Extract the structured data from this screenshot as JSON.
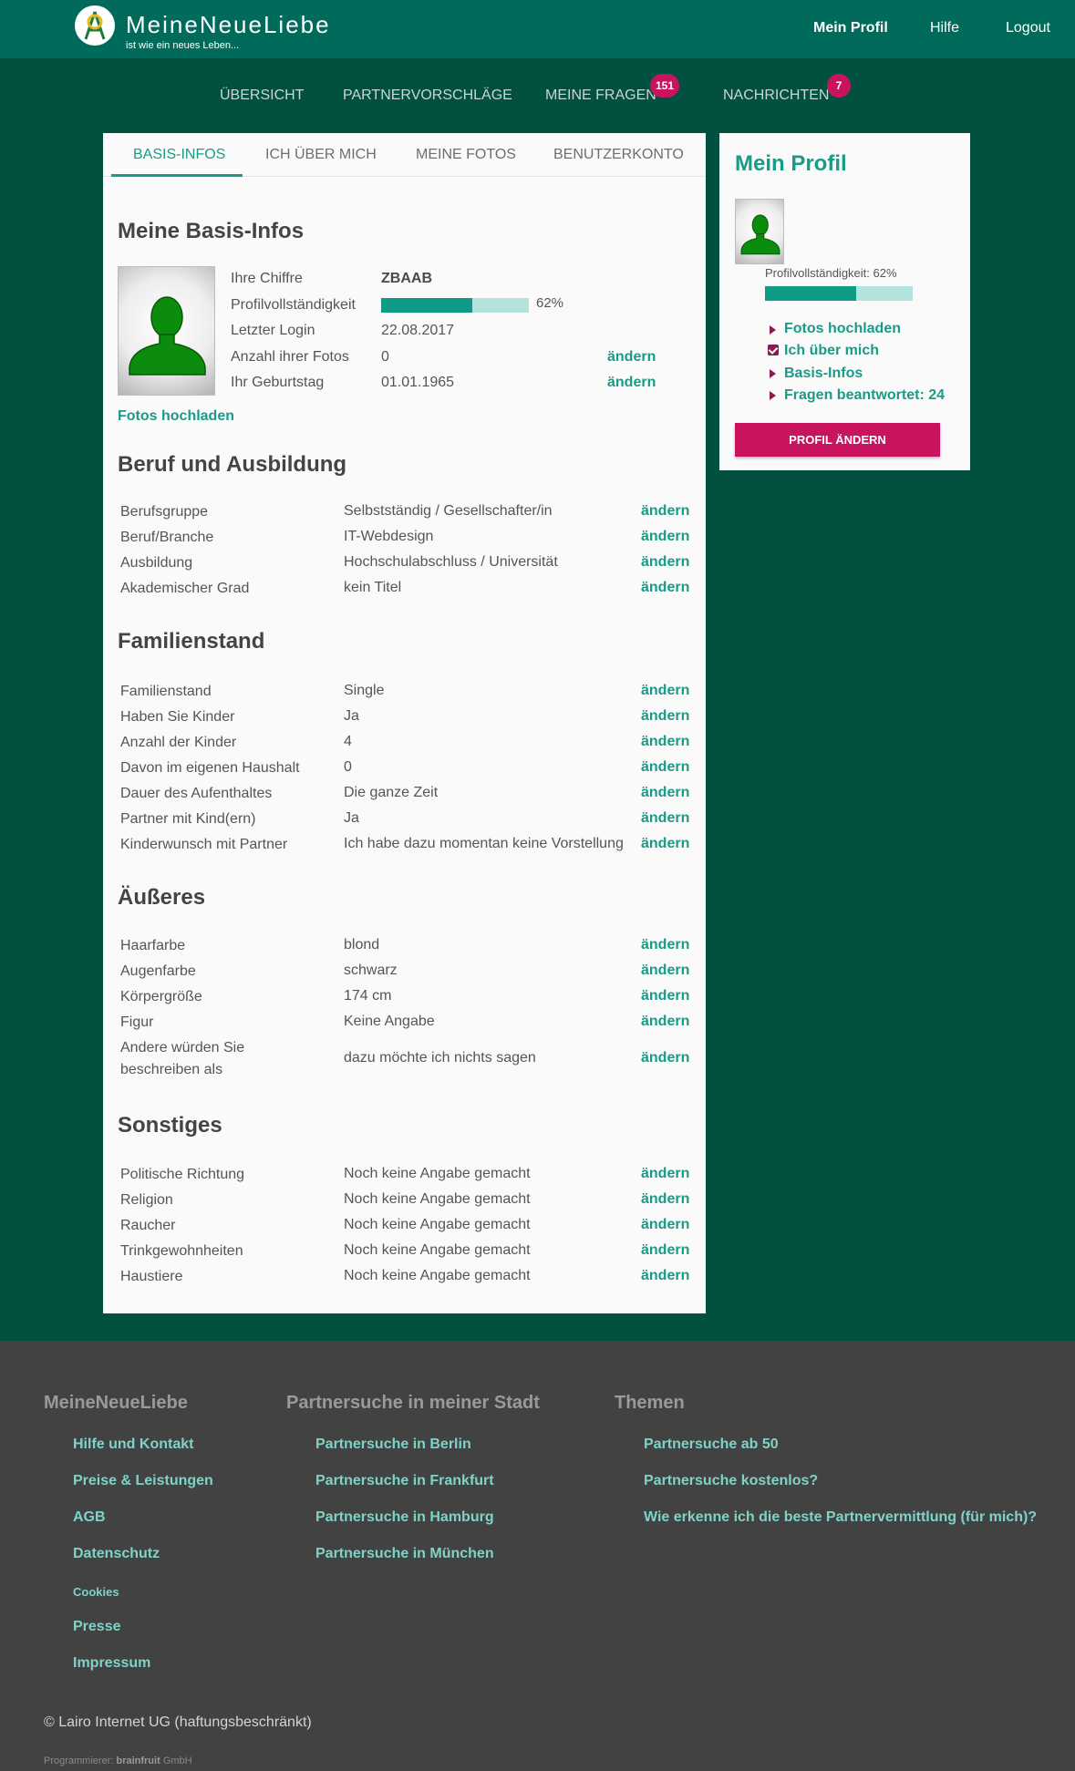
{
  "header": {
    "brand_title": "MeineNeueLiebe",
    "brand_tagline": "ist wie ein neues Leben...",
    "nav": {
      "profile": "Mein Profil",
      "help": "Hilfe",
      "logout": "Logout"
    }
  },
  "main_nav": {
    "items": [
      {
        "label": "Übersicht"
      },
      {
        "label": "Partnervorschläge"
      },
      {
        "label": "Meine Fragen",
        "badge": "151"
      },
      {
        "label": "Nachrichten",
        "badge": "7"
      }
    ]
  },
  "tabs": [
    "Basis-Infos",
    "Ich über mich",
    "Meine Fotos",
    "Benutzerkonto"
  ],
  "basis": {
    "title": "Meine Basis-Infos",
    "chiffre_label": "Ihre Chiffre",
    "chiffre_value": "ZBAAB",
    "completeness_label": "Profilvollständigkeit",
    "completeness_percent": 62,
    "completeness_text": "62%",
    "login_label": "Letzter Login",
    "login_value": "22.08.2017",
    "photos_label": "Anzahl ihrer Fotos",
    "photos_value": "0",
    "birthday_label": "Ihr Geburtstag",
    "birthday_value": "01.01.1965",
    "edit_label": "ändern",
    "upload_label": "Fotos hochladen"
  },
  "sections": [
    {
      "title": "Beruf und Ausbildung",
      "rows": [
        {
          "label": "Berufsgruppe",
          "value": "Selbstständig / Gesellschafter/in"
        },
        {
          "label": "Beruf/Branche",
          "value": "IT-Webdesign"
        },
        {
          "label": "Ausbildung",
          "value": "Hochschulabschluss / Universität"
        },
        {
          "label": "Akademischer Grad",
          "value": "kein Titel"
        }
      ]
    },
    {
      "title": "Familienstand",
      "rows": [
        {
          "label": "Familienstand",
          "value": "Single"
        },
        {
          "label": "Haben Sie Kinder",
          "value": "Ja"
        },
        {
          "label": "Anzahl der Kinder",
          "value": "4"
        },
        {
          "label": "Davon im eigenen Haushalt",
          "value": "0"
        },
        {
          "label": "Dauer des Aufenthaltes",
          "value": "Die ganze Zeit"
        },
        {
          "label": "Partner mit Kind(ern)",
          "value": "Ja"
        },
        {
          "label": "Kinderwunsch mit Partner",
          "value": "Ich habe dazu momentan keine Vorstellung"
        }
      ]
    },
    {
      "title": "Äußeres",
      "rows": [
        {
          "label": "Haarfarbe",
          "value": "blond"
        },
        {
          "label": "Augenfarbe",
          "value": "schwarz"
        },
        {
          "label": "Körpergröße",
          "value": "174 cm"
        },
        {
          "label": "Figur",
          "value": "Keine Angabe"
        },
        {
          "label": "Andere würden Sie beschreiben als",
          "value": "dazu möchte ich nichts sagen"
        }
      ]
    },
    {
      "title": "Sonstiges",
      "rows": [
        {
          "label": "Politische Richtung",
          "value": "Noch keine Angabe gemacht"
        },
        {
          "label": "Religion",
          "value": "Noch keine Angabe gemacht"
        },
        {
          "label": "Raucher",
          "value": "Noch keine Angabe gemacht"
        },
        {
          "label": "Trinkgewohnheiten",
          "value": "Noch keine Angabe gemacht"
        },
        {
          "label": "Haustiere",
          "value": "Noch keine Angabe gemacht"
        }
      ]
    }
  ],
  "side": {
    "title": "Mein Profil",
    "completeness_text": "Profilvollständigkeit: 62%",
    "completeness_percent": 62,
    "items": [
      "Fotos hochladen",
      "Ich über mich",
      "Basis-Infos",
      "Fragen beantwortet: 24"
    ],
    "button_label": "Profil ändern"
  },
  "footer": {
    "col1": {
      "title": "MeineNeueLiebe",
      "links": [
        "Hilfe und Kontakt",
        "Preise & Leistungen",
        "AGB",
        "Datenschutz",
        "Cookies",
        "Presse",
        "Impressum"
      ]
    },
    "col2": {
      "title": "Partnersuche in meiner Stadt",
      "links": [
        "Partnersuche in Berlin",
        "Partnersuche in Frankfurt",
        "Partnersuche in Hamburg",
        "Partnersuche in München"
      ]
    },
    "col3": {
      "title": "Themen",
      "links": [
        "Partnersuche ab 50",
        "Partnersuche kostenlos?",
        "Wie erkenne ich die beste Partnervermittlung (für mich)?"
      ]
    },
    "copyright": "© Lairo Internet UG (haftungsbeschränkt)",
    "programmer_prefix": "Programmierer:",
    "programmer_name": "brainfruit",
    "programmer_suffix": "GmbH"
  },
  "colors": {
    "page_bg": "#02503f",
    "header_bg": "#006b5b",
    "accent": "#1a9b87",
    "badge": "#c8135f",
    "footer_bg": "#424242"
  },
  "icons": {
    "logo": "brand-logo-icon",
    "avatar": "person-silhouette-icon",
    "bullet": "triangle-bullet-icon",
    "checked": "checkbox-checked-icon"
  }
}
